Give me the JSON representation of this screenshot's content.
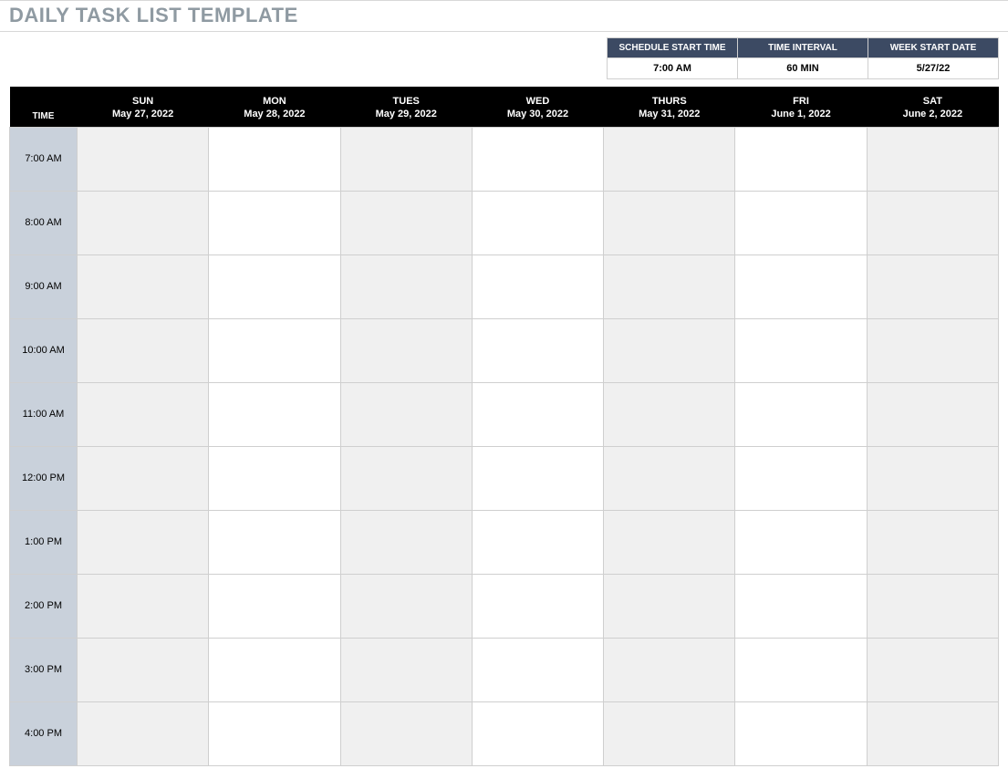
{
  "title": "DAILY TASK LIST TEMPLATE",
  "settings": {
    "headers": {
      "start_time": "SCHEDULE START TIME",
      "interval": "TIME INTERVAL",
      "week_start": "WEEK START DATE"
    },
    "values": {
      "start_time": "7:00 AM",
      "interval": "60 MIN",
      "week_start": "5/27/22"
    }
  },
  "schedule": {
    "time_header": "TIME",
    "days": [
      {
        "name": "SUN",
        "date": "May 27, 2022"
      },
      {
        "name": "MON",
        "date": "May 28, 2022"
      },
      {
        "name": "TUES",
        "date": "May 29, 2022"
      },
      {
        "name": "WED",
        "date": "May 30, 2022"
      },
      {
        "name": "THURS",
        "date": "May 31, 2022"
      },
      {
        "name": "FRI",
        "date": "June 1, 2022"
      },
      {
        "name": "SAT",
        "date": "June 2, 2022"
      }
    ],
    "times": [
      "7:00 AM",
      "8:00 AM",
      "9:00 AM",
      "10:00 AM",
      "11:00 AM",
      "12:00 PM",
      "1:00 PM",
      "2:00 PM",
      "3:00 PM",
      "4:00 PM"
    ],
    "shaded_day_indexes": [
      0,
      2,
      4,
      6
    ]
  }
}
